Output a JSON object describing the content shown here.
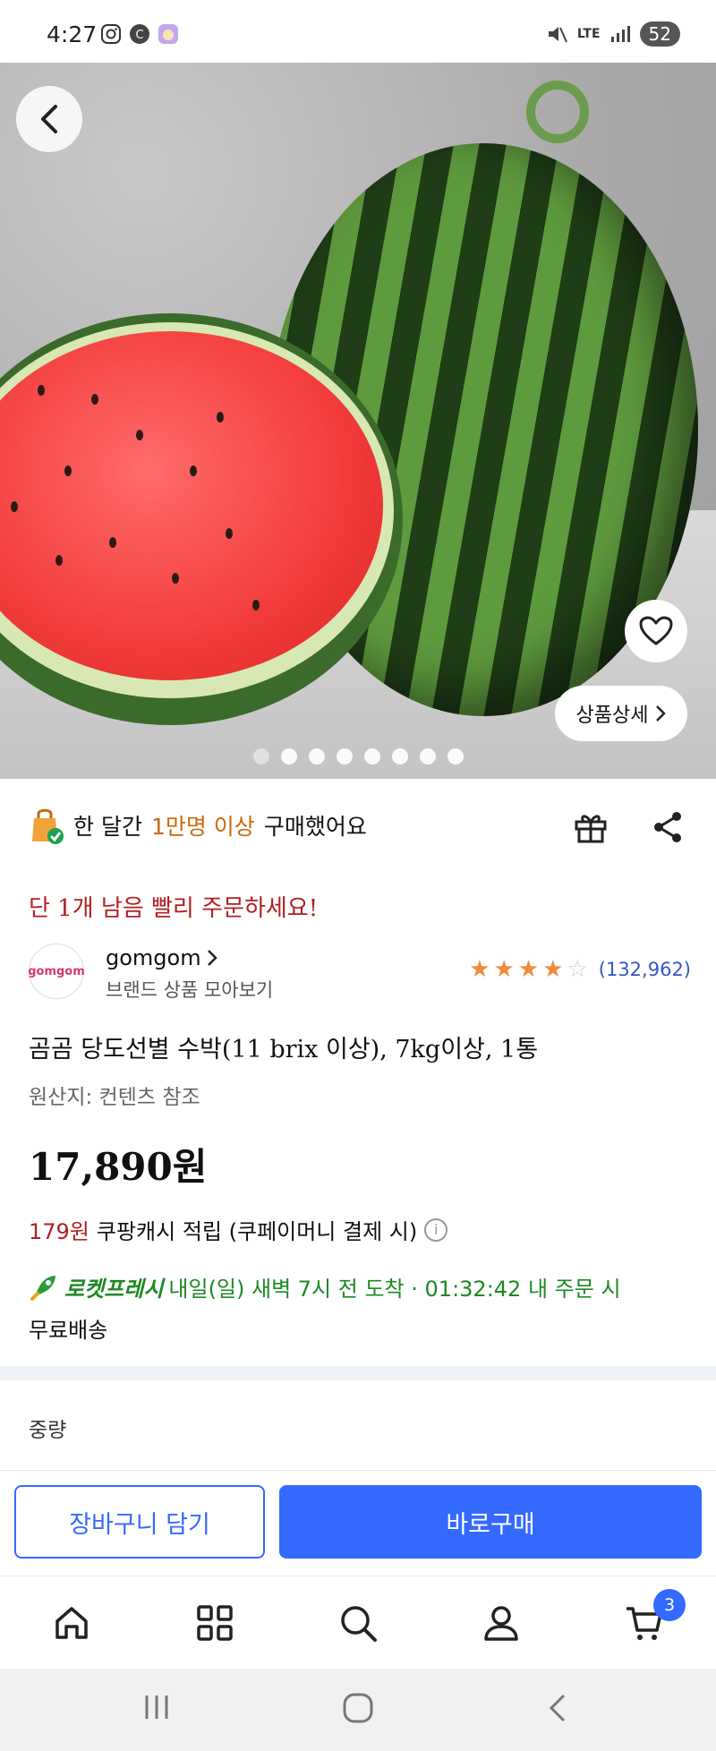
{
  "status_bar": {
    "time": "4:27",
    "network": "LTE",
    "battery": "52"
  },
  "hero": {
    "detail_button_label": "상품상세",
    "dot_count": 8,
    "active_dot": 1
  },
  "purchase": {
    "prefix": "한 달간",
    "count": "1만명 이상",
    "suffix": "구매했어요"
  },
  "urgent_notice": "단 1개 남음 빨리 주문하세요!",
  "seller": {
    "logo_text": "gomgom",
    "name": "gomgom",
    "sub": "브랜드 상품 모아보기",
    "rating": 4,
    "rating_max": 5,
    "review_count": "(132,962)"
  },
  "product": {
    "title": "곰곰 당도선별 수박(11 brix 이상), 7kg이상, 1통",
    "origin": "원산지: 컨텐츠 참조",
    "price": "17,890원",
    "cash_amount": "179원",
    "cash_text": "쿠팡캐시 적립 (쿠페이머니 결제 시)",
    "rocket_brand": "로켓프레시",
    "delivery_text": "내일(일) 새벽 7시 전 도착 · 01:32:42 내 주문 시",
    "free_shipping": "무료배송",
    "option_label": "중량"
  },
  "actions": {
    "cart_label": "장바구니 담기",
    "buy_label": "바로구매"
  },
  "tab_bar": {
    "items": [
      "home",
      "categories",
      "search",
      "my-account",
      "cart"
    ],
    "cart_badge": "3"
  },
  "colors": {
    "accent_blue": "#346aff",
    "urgent_red": "#b31f1f",
    "rocket_green": "#1c8a24",
    "highlight_orange": "#c96a0c",
    "star_orange": "#f08a3c"
  }
}
